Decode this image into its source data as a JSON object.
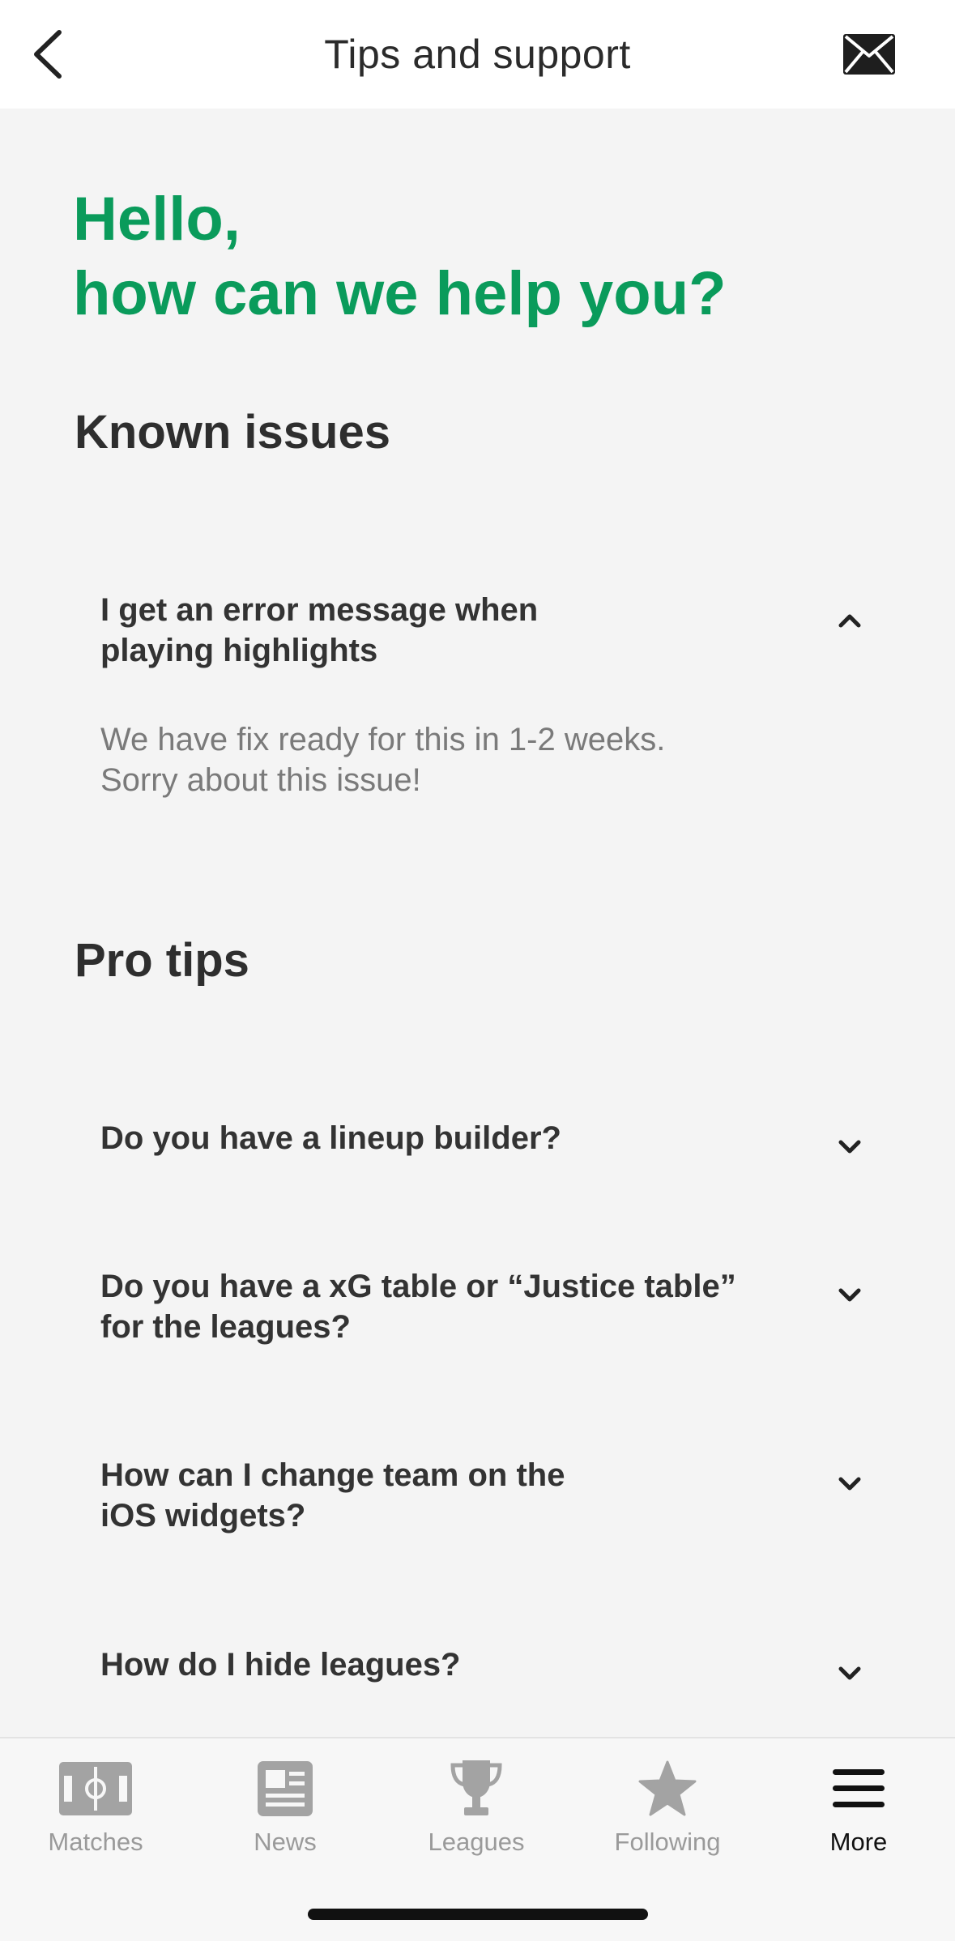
{
  "header": {
    "title": "Tips and support",
    "back_icon": "chevron-left-icon",
    "mail_icon": "envelope-icon"
  },
  "greeting": {
    "line1": "Hello,",
    "line2": "how can we help you?",
    "color": "#0a9b5b"
  },
  "known_issues": {
    "title": "Known issues",
    "items": [
      {
        "question_line1": "I get an error message when",
        "question_line2": "playing highlights",
        "answer_line1": "We have fix ready for this in 1-2 weeks.",
        "answer_line2": "Sorry about this issue!",
        "expanded": true
      }
    ]
  },
  "pro_tips": {
    "title": "Pro tips",
    "items": [
      {
        "question_line1": "Do you have a lineup builder?",
        "question_line2": "",
        "expanded": false
      },
      {
        "question_line1": "Do you have a xG table or “Justice table”",
        "question_line2": "for the leagues?",
        "expanded": false
      },
      {
        "question_line1": "How can I change team on the",
        "question_line2": "iOS widgets?",
        "expanded": false
      },
      {
        "question_line1": "How do I hide leagues?",
        "question_line2": "",
        "expanded": false
      }
    ]
  },
  "tabbar": {
    "tabs": [
      {
        "label": "Matches",
        "icon": "pitch-icon",
        "active": false
      },
      {
        "label": "News",
        "icon": "newspaper-icon",
        "active": false
      },
      {
        "label": "Leagues",
        "icon": "trophy-icon",
        "active": false
      },
      {
        "label": "Following",
        "icon": "star-icon",
        "active": false
      },
      {
        "label": "More",
        "icon": "menu-icon",
        "active": true
      }
    ]
  }
}
